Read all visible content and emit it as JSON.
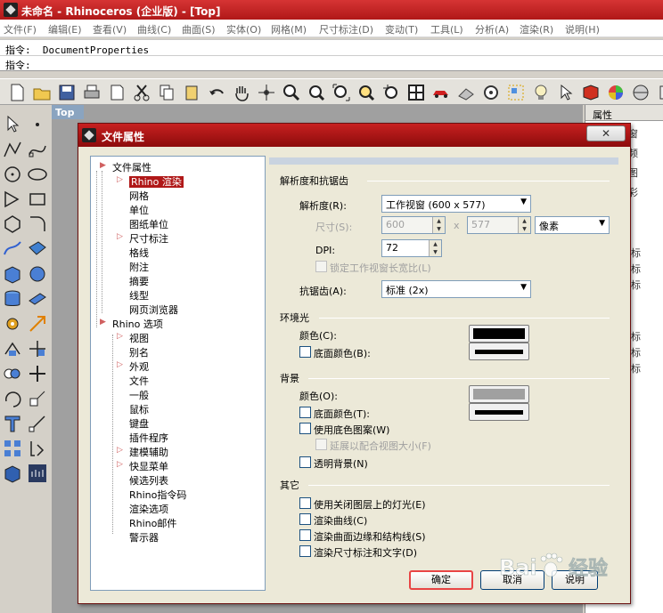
{
  "window": {
    "title": "未命名 - Rhinoceros (企业版) - [Top]",
    "colors": {
      "titlebar": "#c62626",
      "dialog_titlebar": "#b01818",
      "selection": "#b01818"
    }
  },
  "menu": [
    "文件(F)",
    "编辑(E)",
    "查看(V)",
    "曲线(C)",
    "曲面(S)",
    "实体(O)",
    "网格(M)",
    "尺寸标注(D)",
    "变动(T)",
    "工具(L)",
    "分析(A)",
    "渲染(R)",
    "说明(H)"
  ],
  "command": {
    "history": "指令: _DocumentProperties",
    "prompt": "指令:"
  },
  "viewport": {
    "label": "Top"
  },
  "properties_panel": {
    "title": "属性",
    "rows": [
      "窗",
      "频",
      "图",
      "彩",
      "垂标",
      "垂标",
      "垂标",
      "置",
      "垂标",
      "垂标",
      "垂标",
      "案",
      "染",
      "大",
      "个"
    ]
  },
  "dialog": {
    "title": "文件属性",
    "close_label": "✕",
    "tree": [
      {
        "label": "文件属性",
        "level": 0,
        "expandable": true
      },
      {
        "label": "Rhino 渲染",
        "level": 1,
        "expandable": true,
        "selected": true
      },
      {
        "label": "网格",
        "level": 1
      },
      {
        "label": "单位",
        "level": 1
      },
      {
        "label": "图纸单位",
        "level": 1
      },
      {
        "label": "尺寸标注",
        "level": 1,
        "expandable": true
      },
      {
        "label": "格线",
        "level": 1
      },
      {
        "label": "附注",
        "level": 1
      },
      {
        "label": "摘要",
        "level": 1
      },
      {
        "label": "线型",
        "level": 1
      },
      {
        "label": "网页浏览器",
        "level": 1
      },
      {
        "label": "Rhino 选项",
        "level": 0,
        "expandable": true
      },
      {
        "label": "视图",
        "level": 1,
        "expandable": true
      },
      {
        "label": "别名",
        "level": 1
      },
      {
        "label": "外观",
        "level": 1,
        "expandable": true
      },
      {
        "label": "文件",
        "level": 1
      },
      {
        "label": "一般",
        "level": 1
      },
      {
        "label": "鼠标",
        "level": 1
      },
      {
        "label": "键盘",
        "level": 1
      },
      {
        "label": "插件程序",
        "level": 1
      },
      {
        "label": "建模辅助",
        "level": 1,
        "expandable": true
      },
      {
        "label": "快显菜单",
        "level": 1,
        "expandable": true
      },
      {
        "label": "候选列表",
        "level": 1
      },
      {
        "label": "Rhino指令码",
        "level": 1
      },
      {
        "label": "渲染选项",
        "level": 1
      },
      {
        "label": "Rhino邮件",
        "level": 1
      },
      {
        "label": "警示器",
        "level": 1
      }
    ],
    "resolution": {
      "section_title": "解析度和抗锯齿",
      "resolution_label": "解析度(R):",
      "resolution_value": "工作视窗 (600 x 577)",
      "size_label": "尺寸(S):",
      "width": "600",
      "x_label": "x",
      "height": "577",
      "units_value": "像素",
      "dpi_label": "DPI:",
      "dpi_value": "72",
      "lock_aspect_label": "锁定工作视窗长宽比(L)",
      "antialias_label": "抗锯齿(A):",
      "antialias_value": "标准 (2x)"
    },
    "ambient": {
      "section_title": "环境光",
      "color_label": "颜色(C):",
      "color_value": "#000000",
      "bottom_color_label": "底面颜色(B):",
      "bottom_color_value": "#000000"
    },
    "background": {
      "section_title": "背景",
      "color_label": "颜色(O):",
      "color_value": "#a0a0a0",
      "bottom_color_label": "底面颜色(T):",
      "bottom_color_value": "#000000",
      "use_image_label": "使用底色图案(W)",
      "stretch_label": "延展以配合视图大小(F)",
      "transparent_label": "透明背景(N)"
    },
    "other": {
      "section_title": "其它",
      "lights_label": "使用关闭图层上的灯光(E)",
      "curves_label": "渲染曲线(C)",
      "isocurves_label": "渲染曲面边缘和结构线(S)",
      "dimensions_label": "渲染尺寸标注和文字(D)"
    },
    "buttons": {
      "ok": "确定",
      "cancel": "取消",
      "help": "说明"
    }
  },
  "watermark": "Bai 经验"
}
